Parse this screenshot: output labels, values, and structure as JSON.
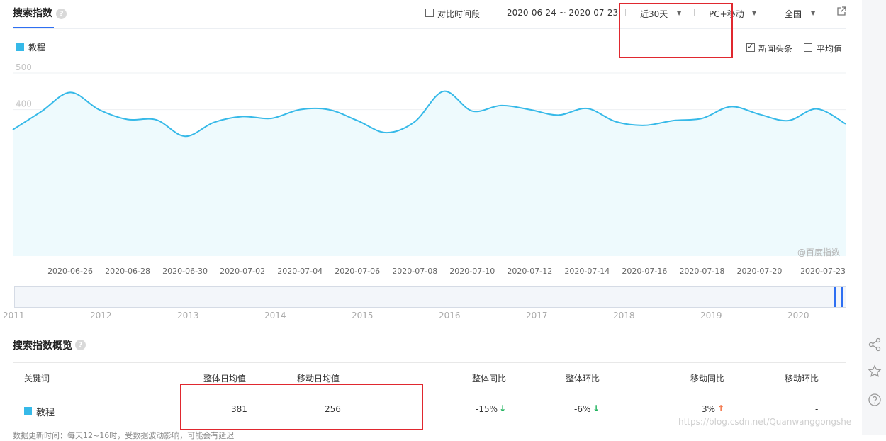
{
  "header": {
    "title": "搜索指数",
    "compare_label": "对比时间段",
    "date_range": "2020-06-24 ~ 2020-07-23",
    "period": "近30天",
    "device": "PC+移动",
    "region": "全国"
  },
  "legend": {
    "series_label": "教程",
    "toggle_news": "新闻头条",
    "toggle_avg": "平均值"
  },
  "watermark": "@百度指数",
  "timeline_years": [
    "2011",
    "2012",
    "2013",
    "2014",
    "2015",
    "2016",
    "2017",
    "2018",
    "2019",
    "2020"
  ],
  "overview": {
    "title": "搜索指数概览",
    "columns": [
      "关键词",
      "整体日均值",
      "移动日均值",
      "整体同比",
      "整体环比",
      "移动同比",
      "移动环比"
    ],
    "row": {
      "keyword": "教程",
      "overall_avg": "381",
      "mobile_avg": "256",
      "overall_yoy": "-15%",
      "overall_mom": "-6%",
      "mobile_yoy": "3%",
      "mobile_mom": "-"
    }
  },
  "footer_note": "数据更新时间：每天12~16时，受数据波动影响，可能会有延迟",
  "side_watermark": "https://blog.csdn.net/Quanwanggongshe",
  "colors": {
    "line": "#36b9e8",
    "area": "#eefafd",
    "accent": "#2e6ff2",
    "highlight": "#e0282f"
  },
  "chart_data": {
    "type": "line",
    "title": "",
    "xlabel": "",
    "ylabel": "",
    "ylim": [
      0,
      500
    ],
    "yticks": [
      100,
      200,
      300,
      400,
      500
    ],
    "x": [
      "2020-06-24",
      "2020-06-25",
      "2020-06-26",
      "2020-06-27",
      "2020-06-28",
      "2020-06-29",
      "2020-06-30",
      "2020-07-01",
      "2020-07-02",
      "2020-07-03",
      "2020-07-04",
      "2020-07-05",
      "2020-07-06",
      "2020-07-07",
      "2020-07-08",
      "2020-07-09",
      "2020-07-10",
      "2020-07-11",
      "2020-07-12",
      "2020-07-13",
      "2020-07-14",
      "2020-07-15",
      "2020-07-16",
      "2020-07-17",
      "2020-07-18",
      "2020-07-19",
      "2020-07-20",
      "2020-07-21",
      "2020-07-22",
      "2020-07-23"
    ],
    "xtick_labels": [
      "2020-06-26",
      "2020-06-28",
      "2020-06-30",
      "2020-07-02",
      "2020-07-04",
      "2020-07-06",
      "2020-07-08",
      "2020-07-10",
      "2020-07-12",
      "2020-07-14",
      "2020-07-16",
      "2020-07-18",
      "2020-07-20",
      "2020-07-23"
    ],
    "series": [
      {
        "name": "教程",
        "values": [
          345,
          395,
          447,
          400,
          373,
          372,
          327,
          365,
          381,
          376,
          400,
          400,
          370,
          337,
          367,
          450,
          396,
          411,
          400,
          385,
          403,
          367,
          357,
          370,
          376,
          408,
          387,
          370,
          402,
          361
        ]
      }
    ],
    "grid": true
  }
}
